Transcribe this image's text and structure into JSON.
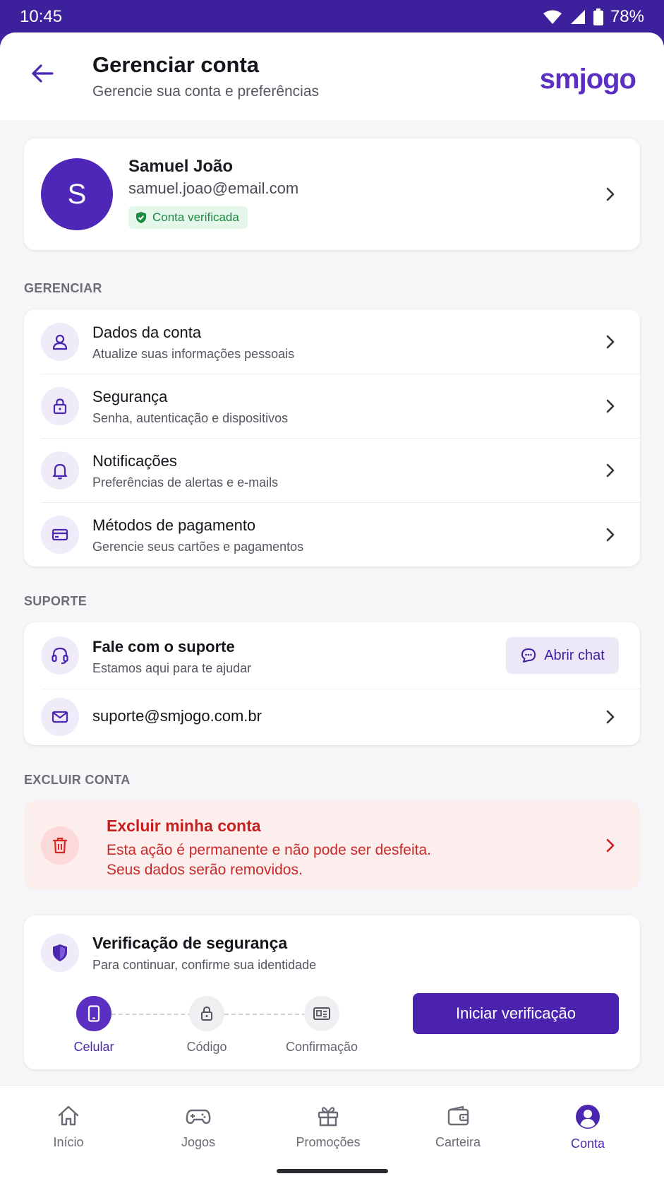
{
  "status_bar": {
    "time": "10:45",
    "battery": "78%"
  },
  "header": {
    "title": "Gerenciar conta",
    "subtitle": "Gerencie sua conta e preferências",
    "logo": "smjogo"
  },
  "profile": {
    "initial": "S",
    "name": "Samuel João",
    "email": "samuel.joao@email.com",
    "badge": "Conta verificada"
  },
  "manage": {
    "heading": "GERENCIAR",
    "items": [
      {
        "title": "Dados da conta",
        "subtitle": "Atualize suas informações pessoais",
        "icon": "user-icon"
      },
      {
        "title": "Segurança",
        "subtitle": "Senha, autenticação e dispositivos",
        "icon": "lock-icon"
      },
      {
        "title": "Notificações",
        "subtitle": "Preferências de alertas e e-mails",
        "icon": "bell-icon"
      },
      {
        "title": "Métodos de pagamento",
        "subtitle": "Gerencie seus cartões e pagamentos",
        "icon": "credit-card-icon"
      }
    ]
  },
  "support": {
    "heading": "SUPORTE",
    "title": "Fale com o suporte",
    "subtitle": "Estamos aqui para te ajudar",
    "chat_button": "Abrir chat",
    "email": "suporte@smjogo.com.br"
  },
  "delete": {
    "heading": "EXCLUIR CONTA",
    "title": "Excluir minha conta",
    "line1": "Esta ação é permanente e não pode ser desfeita.",
    "line2": "Seus dados serão removidos."
  },
  "verification": {
    "title": "Verificação de segurança",
    "subtitle": "Para continuar, confirme sua identidade",
    "steps": [
      "Celular",
      "Código",
      "Confirmação"
    ],
    "button": "Iniciar verificação"
  },
  "nav": {
    "items": [
      "Início",
      "Jogos",
      "Promoções",
      "Carteira",
      "Conta"
    ],
    "active": "Conta"
  },
  "colors": {
    "primary": "#4a22ad",
    "danger": "#c81e1e",
    "success": "#1b8a3e"
  }
}
